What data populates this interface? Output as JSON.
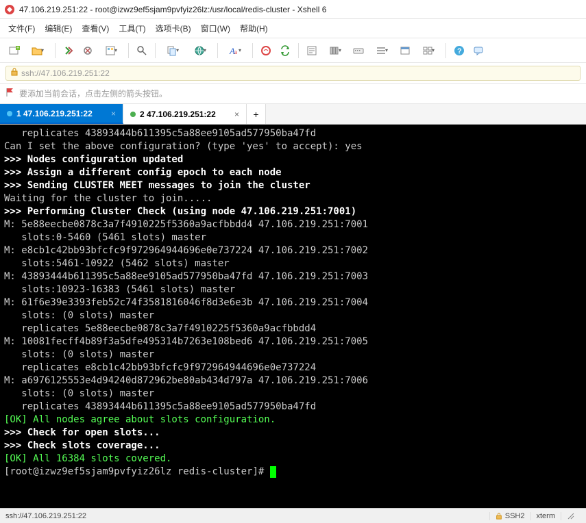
{
  "window": {
    "title": "47.106.219.251:22 - root@izwz9ef5sjam9pvfyiz26lz:/usr/local/redis-cluster - Xshell 6"
  },
  "menus": {
    "file": "文件(F)",
    "edit": "编辑(E)",
    "view": "查看(V)",
    "tools": "工具(T)",
    "tabs": "选项卡(B)",
    "window": "窗口(W)",
    "help": "帮助(H)"
  },
  "addr": {
    "url": "ssh://47.106.219.251:22"
  },
  "hint": {
    "text": "要添加当前会话，点击左侧的箭头按钮。"
  },
  "tabs": [
    {
      "label": "1 47.106.219.251:22",
      "active": true
    },
    {
      "label": "2 47.106.219.251:22",
      "active": false
    }
  ],
  "term": {
    "l0": "   replicates 43893444b611395c5a88ee9105ad577950ba47fd",
    "l1": "Can I set the above configuration? (type 'yes' to accept): yes",
    "l2": ">>> Nodes configuration updated",
    "l3": ">>> Assign a different config epoch to each node",
    "l4": ">>> Sending CLUSTER MEET messages to join the cluster",
    "l5": "Waiting for the cluster to join.....",
    "l6": ">>> Performing Cluster Check (using node 47.106.219.251:7001)",
    "l7": "M: 5e88eecbe0878c3a7f4910225f5360a9acfbbdd4 47.106.219.251:7001",
    "l8": "   slots:0-5460 (5461 slots) master",
    "l9": "M: e8cb1c42bb93bfcfc9f972964944696e0e737224 47.106.219.251:7002",
    "l10": "   slots:5461-10922 (5462 slots) master",
    "l11": "M: 43893444b611395c5a88ee9105ad577950ba47fd 47.106.219.251:7003",
    "l12": "   slots:10923-16383 (5461 slots) master",
    "l13": "M: 61f6e39e3393feb52c74f3581816046f8d3e6e3b 47.106.219.251:7004",
    "l14": "   slots: (0 slots) master",
    "l15": "   replicates 5e88eecbe0878c3a7f4910225f5360a9acfbbdd4",
    "l16": "M: 10081fecff4b89f3a5dfe495314b7263e108bed6 47.106.219.251:7005",
    "l17": "   slots: (0 slots) master",
    "l18": "   replicates e8cb1c42bb93bfcfc9f972964944696e0e737224",
    "l19": "M: a6976125553e4d94240d872962be80ab434d797a 47.106.219.251:7006",
    "l20": "   slots: (0 slots) master",
    "l21": "   replicates 43893444b611395c5a88ee9105ad577950ba47fd",
    "l22": "[OK] All nodes agree about slots configuration.",
    "l23": ">>> Check for open slots...",
    "l24": ">>> Check slots coverage...",
    "l25": "[OK] All 16384 slots covered.",
    "prompt_user": "[root@izwz9ef5sjam9pvfyiz26lz ",
    "prompt_dir": "redis-cluster",
    "prompt_tail": "]# "
  },
  "status": {
    "left": "ssh://47.106.219.251:22",
    "ssh": "SSH2",
    "term": "xterm"
  }
}
